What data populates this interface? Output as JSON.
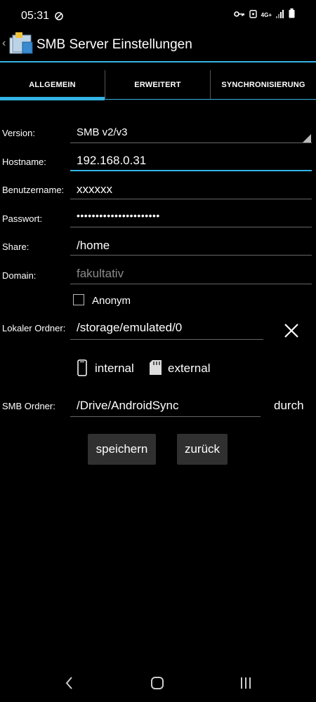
{
  "status": {
    "time": "05:31",
    "network": "4G+"
  },
  "app": {
    "title": "SMB Server Einstellungen"
  },
  "tabs": [
    {
      "label": "ALLGEMEIN",
      "active": true
    },
    {
      "label": "ERWEITERT",
      "active": false
    },
    {
      "label": "SYNCHRONISIERUNG",
      "active": false
    }
  ],
  "form": {
    "version_label": "Version:",
    "version_value": "SMB v2/v3",
    "hostname_label": "Hostname:",
    "hostname_value": "192.168.0.31",
    "username_label": "Benutzername:",
    "username_value": "xxxxxx",
    "password_label": "Passwort:",
    "password_value": "••••••••••••••••••••••",
    "share_label": "Share:",
    "share_value": "/home",
    "domain_label": "Domain:",
    "domain_placeholder": "fakultativ",
    "anonym_label": "Anonym",
    "anonym_checked": false,
    "local_folder_label": "Lokaler Ordner:",
    "local_folder_value": "/storage/emulated/0",
    "internal_label": "internal",
    "external_label": "external",
    "smb_folder_label": "SMB Ordner:",
    "smb_folder_value": "/Drive/AndroidSync",
    "browse_label": "durch"
  },
  "buttons": {
    "save": "speichern",
    "back": "zurück"
  },
  "colors": {
    "accent": "#33b5e5",
    "background": "#000000",
    "button_bg": "#303030"
  }
}
